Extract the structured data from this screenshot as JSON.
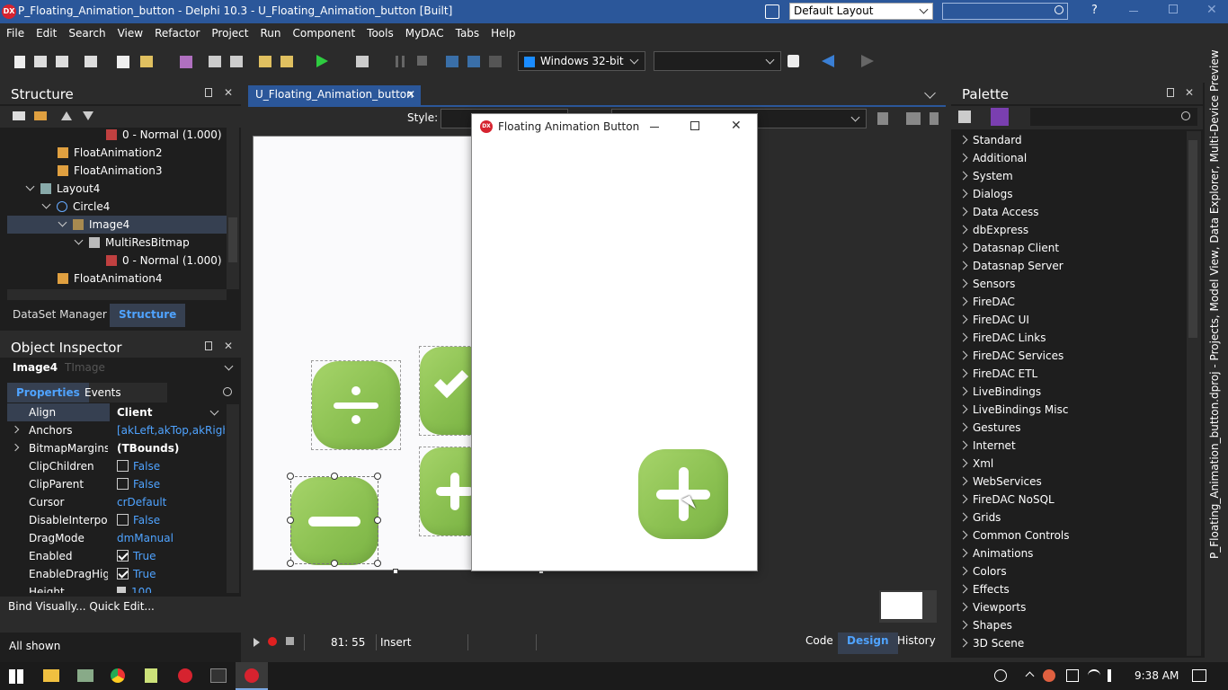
{
  "window": {
    "title": "P_Floating_Animation_button - Delphi 10.3 - U_Floating_Animation_button [Built]",
    "layout_selector": "Default Layout",
    "help_label": "?"
  },
  "menu": [
    "File",
    "Edit",
    "Search",
    "View",
    "Refactor",
    "Project",
    "Run",
    "Component",
    "Tools",
    "MyDAC",
    "Tabs",
    "Help"
  ],
  "toolbar": {
    "platform": "Windows 32-bit",
    "config": ""
  },
  "structure": {
    "title": "Structure",
    "tree": [
      {
        "label": "0 - Normal (1.000)",
        "indent": 4,
        "icon": "bitmap-item-icon"
      },
      {
        "label": "FloatAnimation2",
        "indent": 2,
        "icon": "animation-icon"
      },
      {
        "label": "FloatAnimation3",
        "indent": 2,
        "icon": "animation-icon"
      },
      {
        "label": "Layout4",
        "indent": 2,
        "icon": "layout-icon",
        "expanded": true
      },
      {
        "label": "Circle4",
        "indent": 3,
        "icon": "circle-icon",
        "expanded": true
      },
      {
        "label": "Image4",
        "indent": 4,
        "icon": "image-icon",
        "expanded": true,
        "selected": true
      },
      {
        "label": "MultiResBitmap",
        "indent": 5,
        "icon": "bitmap-icon",
        "expanded": true
      },
      {
        "label": "0 - Normal (1.000)",
        "indent": 6,
        "icon": "bitmap-item-icon"
      },
      {
        "label": "FloatAnimation4",
        "indent": 2,
        "icon": "animation-icon"
      }
    ],
    "tabs": [
      "DataSet Manager",
      "Structure"
    ],
    "active_tab": "Structure"
  },
  "inspector": {
    "title": "Object Inspector",
    "object": "Image4",
    "object_type": "TImage",
    "tabs": [
      "Properties",
      "Events"
    ],
    "active_tab": "Properties",
    "rows": [
      {
        "name": "Align",
        "value": "Client",
        "selected": true
      },
      {
        "name": "Anchors",
        "value": "[akLeft,akTop,akRight,a",
        "expand": true
      },
      {
        "name": "BitmapMargins",
        "value": "(TBounds)",
        "expand": true,
        "bold": true
      },
      {
        "name": "ClipChildren",
        "value": "False",
        "checkbox": false
      },
      {
        "name": "ClipParent",
        "value": "False",
        "checkbox": false
      },
      {
        "name": "Cursor",
        "value": "crDefault"
      },
      {
        "name": "DisableInterpolat",
        "value": "False",
        "checkbox": false
      },
      {
        "name": "DragMode",
        "value": "dmManual"
      },
      {
        "name": "Enabled",
        "value": "True",
        "checkbox": true
      },
      {
        "name": "EnableDragHigh",
        "value": "True",
        "checkbox": true
      },
      {
        "name": "Height",
        "value": "100"
      }
    ],
    "footer_links": "Bind Visually...  Quick Edit...",
    "status": "All shown"
  },
  "editor": {
    "tab": "U_Floating_Animation_button",
    "style_label": "Style:",
    "cursor_pos": "81:  55",
    "mode": "Insert",
    "bottom_tabs": [
      "Code",
      "Design",
      "History"
    ],
    "active_bottom_tab": "Design"
  },
  "floating_window": {
    "title": "Floating Animation Button"
  },
  "palette": {
    "title": "Palette",
    "categories": [
      "Standard",
      "Additional",
      "System",
      "Dialogs",
      "Data Access",
      "dbExpress",
      "Datasnap Client",
      "Datasnap Server",
      "Sensors",
      "FireDAC",
      "FireDAC UI",
      "FireDAC Links",
      "FireDAC Services",
      "FireDAC ETL",
      "LiveBindings",
      "LiveBindings Misc",
      "Gestures",
      "Internet",
      "Xml",
      "WebServices",
      "FireDAC NoSQL",
      "Grids",
      "Common Controls",
      "Animations",
      "Colors",
      "Effects",
      "Viewports",
      "Shapes",
      "3D Scene"
    ],
    "side_tab": "P_Floating_Animation_button.dproj - Projects, Model View, Data Explorer, Multi-Device Preview"
  },
  "taskbar": {
    "time": "9:38 AM"
  },
  "colors": {
    "accent": "#2b579a",
    "selection": "#364051",
    "green": "#8cc152",
    "link": "#4fa3ff"
  }
}
